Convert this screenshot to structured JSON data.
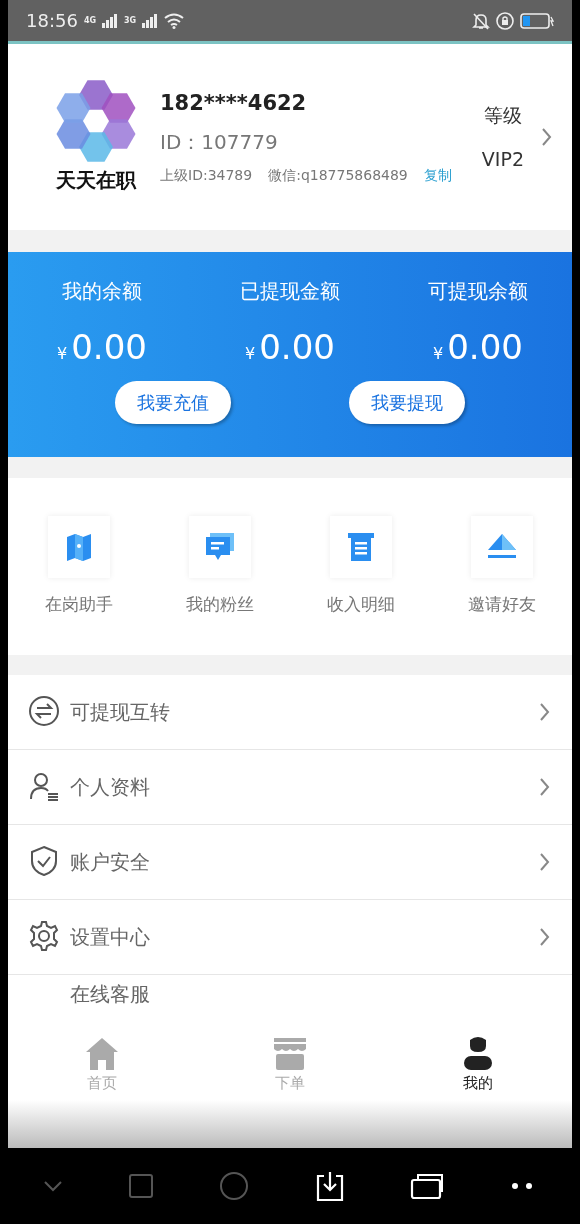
{
  "status_bar": {
    "time": "18:56",
    "networks": [
      "4G",
      "3G"
    ]
  },
  "profile": {
    "logo_text": "天天在职",
    "phone": "182****4622",
    "id": "ID：107779",
    "parent_id": "上级ID:34789",
    "wechat": "微信:q18775868489",
    "copy": "复制",
    "level_label": "等级",
    "level": "VIP2"
  },
  "balance": {
    "items": [
      {
        "label": "我的余额",
        "currency": "¥",
        "amount": "0.00"
      },
      {
        "label": "已提现金额",
        "currency": "¥",
        "amount": "0.00"
      },
      {
        "label": "可提现余额",
        "currency": "¥",
        "amount": "0.00"
      }
    ],
    "buttons": [
      "我要充值",
      "我要提现"
    ]
  },
  "shortcuts": [
    {
      "kind": "map",
      "label": "在岗助手"
    },
    {
      "kind": "chat",
      "label": "我的粉丝"
    },
    {
      "kind": "receipt",
      "label": "收入明细"
    },
    {
      "kind": "invite",
      "label": "邀请好友"
    }
  ],
  "menu": [
    {
      "kind": "transfer",
      "label": "可提现互转"
    },
    {
      "kind": "user",
      "label": "个人资料"
    },
    {
      "kind": "shield",
      "label": "账户安全"
    },
    {
      "kind": "gear",
      "label": "设置中心"
    },
    {
      "kind": "service",
      "label": "在线客服"
    }
  ],
  "tab_bar": [
    {
      "kind": "home",
      "label": "首页",
      "selected": false
    },
    {
      "kind": "shop",
      "label": "下单",
      "selected": false
    },
    {
      "kind": "me",
      "label": "我的",
      "selected": true
    }
  ]
}
